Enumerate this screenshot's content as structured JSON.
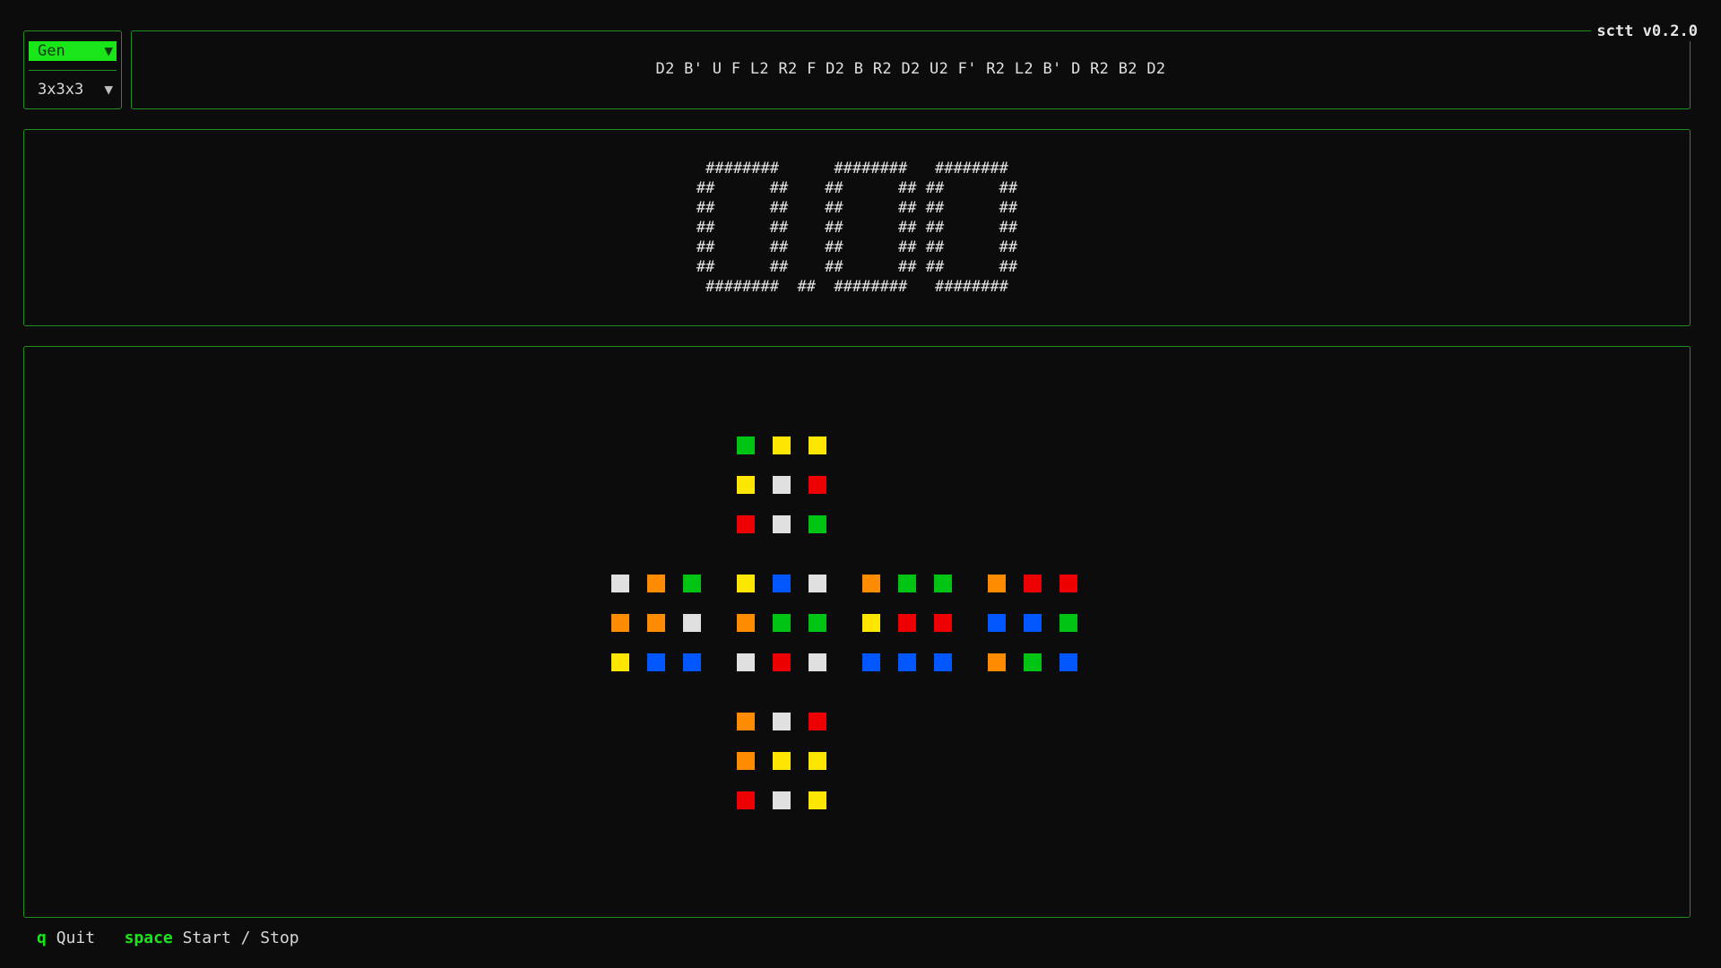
{
  "app_version": "sctt v0.2.0",
  "selector": {
    "mode": "Gen",
    "puzzle": "3x3x3"
  },
  "scramble": "D2 B' U F L2 R2 F D2 B R2 D2 U2 F' R2 L2 B' D R2 B2 D2",
  "timer_display": [
    " ########      ########   ######## ",
    "##      ##    ##      ## ##      ##",
    "##      ##    ##      ## ##      ##",
    "##      ##    ##      ## ##      ##",
    "##      ##    ##      ## ##      ##",
    "##      ##    ##      ## ##      ##",
    " ########  ##  ########   ######## "
  ],
  "colors": {
    "W": "#e0e0e0",
    "Y": "#ffe600",
    "G": "#00c414",
    "B": "#0057ff",
    "R": "#ee0000",
    "O": "#ff8c00",
    "accent": "#19e619",
    "border": "#1f8f1f",
    "background": "#0c0c0c"
  },
  "cube_net": {
    "top": [
      [
        "G",
        "Y",
        "Y"
      ],
      [
        "Y",
        "W",
        "R"
      ],
      [
        "R",
        "W",
        "G"
      ]
    ],
    "left": [
      [
        "W",
        "O",
        "G"
      ],
      [
        "O",
        "O",
        "W"
      ],
      [
        "Y",
        "B",
        "B"
      ]
    ],
    "front": [
      [
        "Y",
        "B",
        "W"
      ],
      [
        "O",
        "G",
        "G"
      ],
      [
        "W",
        "R",
        "W"
      ]
    ],
    "right": [
      [
        "O",
        "G",
        "G"
      ],
      [
        "Y",
        "R",
        "R"
      ],
      [
        "B",
        "B",
        "B"
      ]
    ],
    "back": [
      [
        "O",
        "R",
        "R"
      ],
      [
        "B",
        "B",
        "G"
      ],
      [
        "O",
        "G",
        "B"
      ]
    ],
    "bottom": [
      [
        "O",
        "W",
        "R"
      ],
      [
        "O",
        "Y",
        "Y"
      ],
      [
        "R",
        "W",
        "Y"
      ]
    ]
  },
  "footer": {
    "quit_key": "q",
    "quit_label": "Quit",
    "start_key": "space",
    "start_label": "Start / Stop"
  }
}
